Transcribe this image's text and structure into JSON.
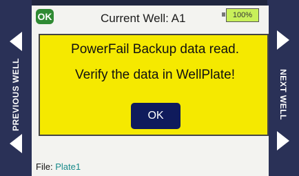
{
  "header": {
    "status_badge": "OK",
    "title": "Current Well: A1",
    "battery": "100%"
  },
  "side": {
    "left_label": "PREVIOUS WELL",
    "right_label": "NEXT WELL"
  },
  "dialog": {
    "line1": "PowerFail Backup data read.",
    "line2": "Verify the data in WellPlate!",
    "ok_label": "OK"
  },
  "footer": {
    "file_label": "File:",
    "file_name": "Plate1"
  },
  "icons": {
    "left_arrows": "left-arrow-icon",
    "right_arrows": "right-arrow-icon"
  },
  "colors": {
    "dialog_bg": "#f5e900",
    "button_bg": "#0f1b5c",
    "badge_bg": "#2f8a33",
    "battery_bg": "#c8f05a"
  }
}
